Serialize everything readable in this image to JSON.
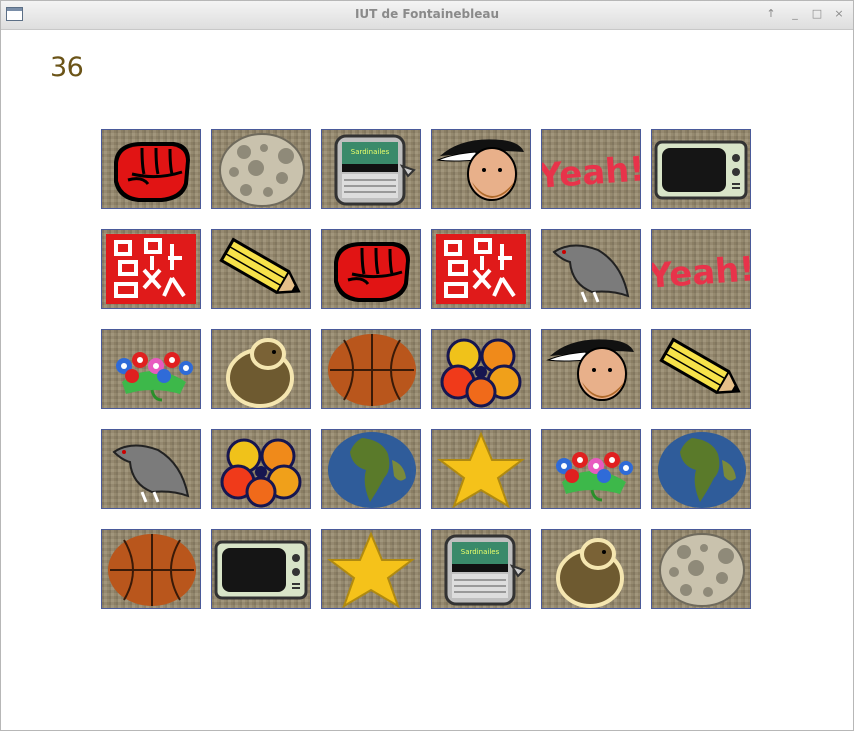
{
  "window": {
    "title": "IUT de Fontainebleau",
    "controls": [
      "up-arrow-icon",
      "minimize-icon",
      "maximize-icon",
      "close-icon"
    ]
  },
  "game": {
    "score": "36",
    "board": {
      "rows": 5,
      "cols": 6,
      "cards": [
        [
          "fist",
          "moon",
          "sardines",
          "king-henry",
          "yeah",
          "tv"
        ],
        [
          "chinese-seal",
          "pencil",
          "fist",
          "chinese-seal",
          "pigeon",
          "yeah"
        ],
        [
          "flower-bunch",
          "marmot",
          "basketball",
          "flower",
          "king-henry",
          "pencil"
        ],
        [
          "pigeon",
          "flower",
          "earth",
          "star",
          "flower-bunch",
          "earth"
        ],
        [
          "basketball",
          "tv",
          "star",
          "sardines",
          "marmot",
          "moon"
        ]
      ],
      "texts": {
        "yeah": "Yeah!",
        "sardines": "Sardinailes"
      }
    }
  },
  "colors": {
    "card_bg": "#978a6e",
    "card_border": "#4a5a9a",
    "score_text": "#6b5418"
  }
}
